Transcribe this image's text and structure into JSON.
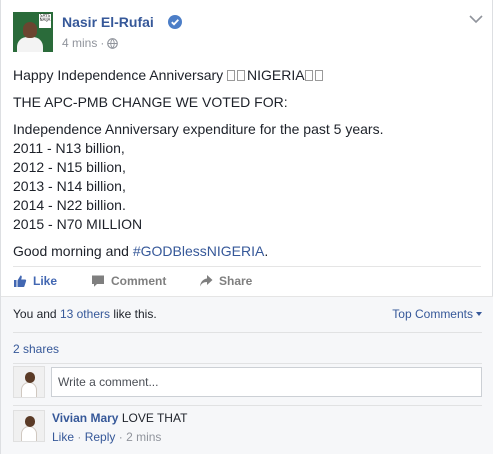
{
  "post": {
    "author": "Nasir El-Rufai",
    "time": "4 mins",
    "dot": "·",
    "avatar_tag": "SAYS NAIJA",
    "lines": {
      "l1": "Happy Independence Anniversary ",
      "l1_word": "NIGERIA",
      "l2": "THE APC-PMB CHANGE WE VOTED FOR:",
      "l3": "Independence Anniversary expenditure for the past 5 years.",
      "l4": "2011 - N13 billion,",
      "l5": "2012 - N15 billion,",
      "l6": "2013 - N14 billion,",
      "l7": "2014 - N22 billion.",
      "l8": "2015 - N70 MILLION",
      "l9_pre": "Good morning and ",
      "l9_tag": "#GODBlessNIGERIA",
      "l9_post": "."
    }
  },
  "actions": {
    "like": "Like",
    "comment": "Comment",
    "share": "Share"
  },
  "ufi": {
    "likes_pre": "You and ",
    "likes_link": "13 others",
    "likes_post": " like this.",
    "top_comments": "Top Comments",
    "shares": "2 shares",
    "comment_placeholder": "Write a comment..."
  },
  "comment": {
    "author": "Vivian Mary",
    "text": "LOVE THAT",
    "like": "Like",
    "reply": "Reply",
    "sep": "·",
    "time": "2 mins"
  },
  "colors": {
    "link": "#365899",
    "like_active": "#4267b2",
    "muted": "#90949c"
  }
}
